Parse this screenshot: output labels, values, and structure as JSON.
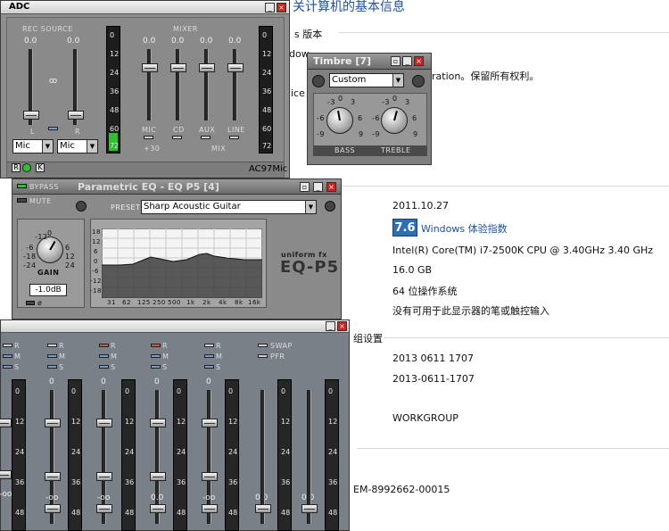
{
  "background": {
    "title": "关计算机的基本信息",
    "edition_heading": "s 版本",
    "edition_partial": "dow",
    "edition_partial_2": "ration。保留所有权利。",
    "edition_partial_3": "ice",
    "rating_date": "2011.10.27",
    "rating_score": "7.6",
    "rating_link": "Windows 体验指数",
    "processor": "Intel(R) Core(TM) i7-2500K CPU @ 3.40GHz   3.40 GHz",
    "memory": "16.0 GB",
    "system_type": "64 位操作系统",
    "pen_touch": "没有可用于此显示器的笔或触控输入",
    "computer_section": "组设置",
    "computer_name": "2013 0611 1707",
    "full_name": "2013-0611-1707",
    "workgroup": "WORKGROUP",
    "product_id_partial": "EM-8992662-00015"
  },
  "adc": {
    "title": "ADC",
    "rec_source_label": "REC SOURCE",
    "mixer_label": "MIXER",
    "rec_values": [
      "0.0",
      "0.0"
    ],
    "link_label": "ꝏ",
    "channel_l": "L",
    "channel_r": "R",
    "source_left": "Mic",
    "source_right": "Mic",
    "mixer_values": [
      "0.0",
      "0.0",
      "0.0",
      "0.0"
    ],
    "mixer_channels": [
      "MIC",
      "CD",
      "AUX",
      "LINE"
    ],
    "meter_ticks": [
      "0",
      "12",
      "24",
      "36",
      "48",
      "60",
      "72"
    ],
    "plus30": "+30",
    "mix_label": "MIX",
    "rlk": [
      "R",
      "L",
      "K"
    ],
    "device": "AC97Mic"
  },
  "timbre": {
    "title": "Timbre [7]",
    "preset": "Custom",
    "bass_label": "BASS",
    "treble_label": "TREBLE",
    "scale": [
      "-3",
      "0",
      "3",
      "-6",
      "6",
      "-9",
      "9"
    ]
  },
  "eq": {
    "title": "Parametric EQ - EQ P5 [4]",
    "bypass_label": "BYPASS",
    "mute_label": "MUTE",
    "preset_label": "PRESET",
    "preset_value": "Sharp Acoustic Guitar",
    "gain_label": "GAIN",
    "gain_value": "-1.0dB",
    "gain_scale": [
      "-12",
      "0",
      "-6",
      "6",
      "-18",
      "12",
      "-24",
      "24"
    ],
    "brand": "uniform fx",
    "product": "EQ-P5",
    "db_ticks": [
      "18",
      "12",
      "6",
      "0",
      "-6",
      "-12",
      "-18"
    ],
    "freq_ticks": [
      "31",
      "62",
      "125",
      "250",
      "500",
      "1k",
      "2k",
      "4k",
      "8k",
      "16k"
    ],
    "phase": "ø"
  },
  "mixer2": {
    "channels": [
      {
        "value": "0",
        "bottom": "-oo",
        "btn_color": "gray"
      },
      {
        "value": "0",
        "bottom": "-oo",
        "btn_color": "red"
      },
      {
        "value": "0",
        "bottom": "0.0",
        "btn_color": "red"
      },
      {
        "value": "0",
        "bottom": "-oo",
        "btn_color": "gray"
      }
    ],
    "first_bottom": "-oo",
    "labels_r": "R",
    "labels_m": "M",
    "labels_s": "S",
    "swap": "SWAP",
    "pfr": "PFR",
    "meter_ticks": [
      "0",
      "12",
      "24",
      "36",
      "48"
    ],
    "extra_values": [
      "0.0",
      "0.0"
    ]
  }
}
